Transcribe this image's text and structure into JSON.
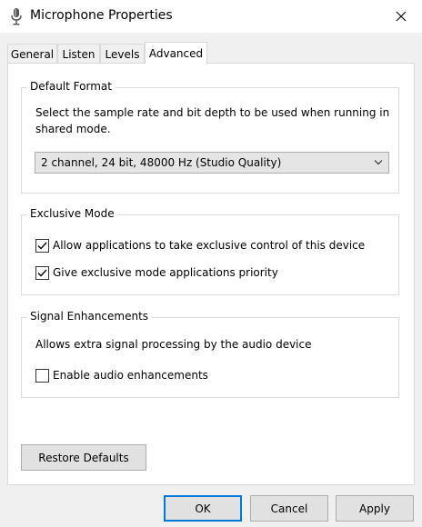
{
  "window": {
    "title": "Microphone Properties",
    "close_icon": "close-icon"
  },
  "tabs": [
    {
      "label": "General"
    },
    {
      "label": "Listen"
    },
    {
      "label": "Levels"
    },
    {
      "label": "Advanced",
      "active": true
    }
  ],
  "default_format": {
    "legend": "Default Format",
    "description": "Select the sample rate and bit depth to be used when running in shared mode.",
    "selected": "2 channel, 24 bit, 48000 Hz (Studio Quality)"
  },
  "exclusive_mode": {
    "legend": "Exclusive Mode",
    "allow_exclusive": {
      "label": "Allow applications to take exclusive control of this device",
      "checked": true
    },
    "priority": {
      "label": "Give exclusive mode applications priority",
      "checked": true
    }
  },
  "signal_enhancements": {
    "legend": "Signal Enhancements",
    "description": "Allows extra signal processing by the audio device",
    "enable": {
      "label": "Enable audio enhancements",
      "checked": false
    }
  },
  "buttons": {
    "restore_defaults": "Restore Defaults",
    "ok": "OK",
    "cancel": "Cancel",
    "apply": "Apply"
  },
  "colors": {
    "accent": "#0078d7",
    "window_bg": "#f0f0f0",
    "panel_bg": "#ffffff"
  }
}
